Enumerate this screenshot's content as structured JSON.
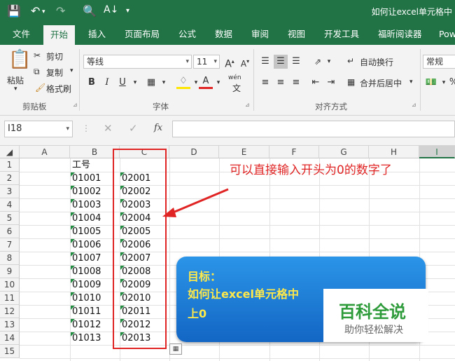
{
  "window": {
    "title": "如何让excel单元格中"
  },
  "tabs": [
    {
      "label": "文件"
    },
    {
      "label": "开始"
    },
    {
      "label": "插入"
    },
    {
      "label": "页面布局"
    },
    {
      "label": "公式"
    },
    {
      "label": "数据"
    },
    {
      "label": "审阅"
    },
    {
      "label": "视图"
    },
    {
      "label": "开发工具"
    },
    {
      "label": "福昕阅读器"
    },
    {
      "label": "Pow"
    }
  ],
  "ribbon": {
    "clipboard": {
      "paste": "粘贴",
      "cut": "剪切",
      "copy": "复制",
      "format_painter": "格式刷",
      "group": "剪贴板"
    },
    "font": {
      "name": "等线",
      "size": "11",
      "group": "字体",
      "phonetic": "wén"
    },
    "alignment": {
      "wrap": "自动换行",
      "merge": "合并后居中",
      "group": "对齐方式"
    },
    "number": {
      "format": "常规"
    }
  },
  "formula_bar": {
    "name_box": "I18",
    "fx": "fx",
    "value": ""
  },
  "sheet": {
    "columns": [
      "A",
      "B",
      "C",
      "D",
      "E",
      "F",
      "G",
      "H",
      "I"
    ],
    "rows": [
      "1",
      "2",
      "3",
      "4",
      "5",
      "6",
      "7",
      "8",
      "9",
      "10",
      "11",
      "12",
      "13",
      "14",
      "15"
    ],
    "col_b": [
      "工号",
      "01001",
      "01002",
      "01003",
      "01004",
      "01005",
      "01006",
      "01007",
      "01008",
      "01009",
      "01010",
      "01011",
      "01012",
      "01013"
    ],
    "col_c": [
      "",
      "02001",
      "02002",
      "02003",
      "02004",
      "02005",
      "02006",
      "02007",
      "02008",
      "02009",
      "02010",
      "02011",
      "02012",
      "02013"
    ]
  },
  "annotation": "可以直接输入开头为0的数字了",
  "callout": {
    "line1": "目标：",
    "line2": "如何让excel单元格中",
    "line3": "上0"
  },
  "watermark": {
    "title": "百科全说",
    "subtitle": "助你轻松解决"
  },
  "colors": {
    "excel_green": "#217346",
    "annotation_red": "#e02424",
    "callout_blue": "#1f7fd8",
    "callout_text": "#ffe94a"
  }
}
